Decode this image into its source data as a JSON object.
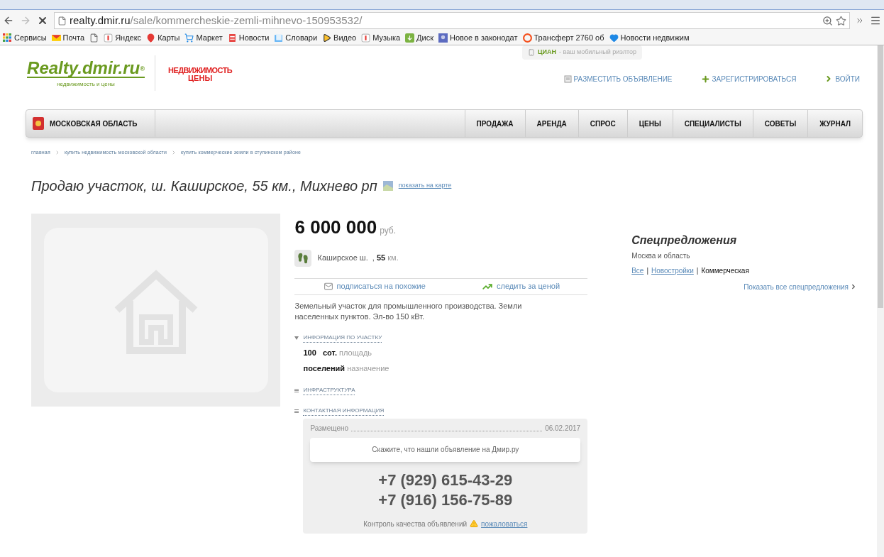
{
  "browser": {
    "url_host": "realty.dmir.ru",
    "url_path": "/sale/kommercheskie-zemli-mihnevo-150953532/",
    "bookmarks": [
      {
        "label": "Сервисы",
        "kind": "apps"
      },
      {
        "label": "Почта",
        "kind": "mail"
      },
      {
        "kind": "page"
      },
      {
        "label": "Яндекс",
        "kind": "yandex"
      },
      {
        "label": "Карты",
        "kind": "pin"
      },
      {
        "label": "Маркет",
        "kind": "cart"
      },
      {
        "label": "Новости",
        "kind": "news"
      },
      {
        "label": "Словари",
        "kind": "book"
      },
      {
        "label": "Видео",
        "kind": "play"
      },
      {
        "label": "Музыка",
        "kind": "yandex"
      },
      {
        "label": "Диск",
        "kind": "disk"
      },
      {
        "label": "Новое в законодат",
        "kind": "law"
      },
      {
        "label": "Трансферт 2760 об",
        "kind": "ring"
      },
      {
        "label": "Новости недвижим",
        "kind": "heart"
      }
    ]
  },
  "header": {
    "logo": "Realty.dmir.ru",
    "logo_mark": "®",
    "logo_tagline": "недвижимость и цены",
    "partner_logo_top": "НЕДВИЖИМОСТЬ",
    "partner_logo_bottom": "ЦЕНЫ",
    "promo_brand": "ЦИАН",
    "promo_text": "- ваш мобильный риэлтор",
    "actions": [
      {
        "label": "РАЗМЕСТИТЬ ОБЪЯВЛЕНИЕ",
        "kind": "post"
      },
      {
        "label": "ЗАРЕГИСТРИРОВАТЬСЯ",
        "kind": "plus"
      },
      {
        "label": "ВОЙТИ",
        "kind": "arrow"
      }
    ]
  },
  "nav": {
    "region": "МОСКОВСКАЯ ОБЛАСТЬ",
    "items": [
      "ПРОДАЖА",
      "АРЕНДА",
      "СПРОС",
      "ЦЕНЫ",
      "СПЕЦИАЛИСТЫ",
      "СОВЕТЫ",
      "ЖУРНАЛ"
    ]
  },
  "breadcrumbs": [
    "главная",
    "купить недвижимость московской области",
    "купить коммерческие земли в ступинском районе"
  ],
  "title": "Продаю участок, ш. Каширское, 55 км., Михнево рп",
  "map_link": "показать на карте",
  "listing": {
    "price": "6 000 000",
    "currency": "руб.",
    "road": "Каширское ш.  ,",
    "distance": "55",
    "distance_unit": "км.",
    "subscribe": "подписаться на похожие",
    "watch_price": "следить за ценой",
    "description": "Земельный участок для промышленного производства. Земли населенных пунктов. Эл-во 150 кВт.",
    "sections": [
      {
        "title": "ИНФОРМАЦИЯ ПО УЧАСТКУ",
        "expanded": true,
        "rows": [
          {
            "value": "100   сот.",
            "label": "площадь"
          },
          {
            "value": "поселений",
            "label": "назначение"
          }
        ]
      },
      {
        "title": "ИНФРАСТРУКТУРА",
        "expanded": false
      },
      {
        "title": "КОНТАКТНАЯ ИНФОРМАЦИЯ",
        "expanded": false
      }
    ],
    "contact": {
      "posted_label": "Размещено",
      "posted_date": "06.02.2017",
      "notice": "Скажите, что нашли объявление на Дмир.ру",
      "phones": [
        "+7 (929) 615-43-29",
        "+7 (916) 156-75-89"
      ],
      "quality": "Контроль качества объявлений",
      "complain": "пожаловаться"
    }
  },
  "special": {
    "title": "Спецпредложения",
    "region": "Москва и область",
    "filter_separator": "|",
    "filters": [
      {
        "label": "Все",
        "selected": false
      },
      {
        "label": "Новостройки",
        "selected": false
      },
      {
        "label": "Коммерческая",
        "selected": true
      }
    ],
    "show_all": "Показать все спецпредложения"
  }
}
